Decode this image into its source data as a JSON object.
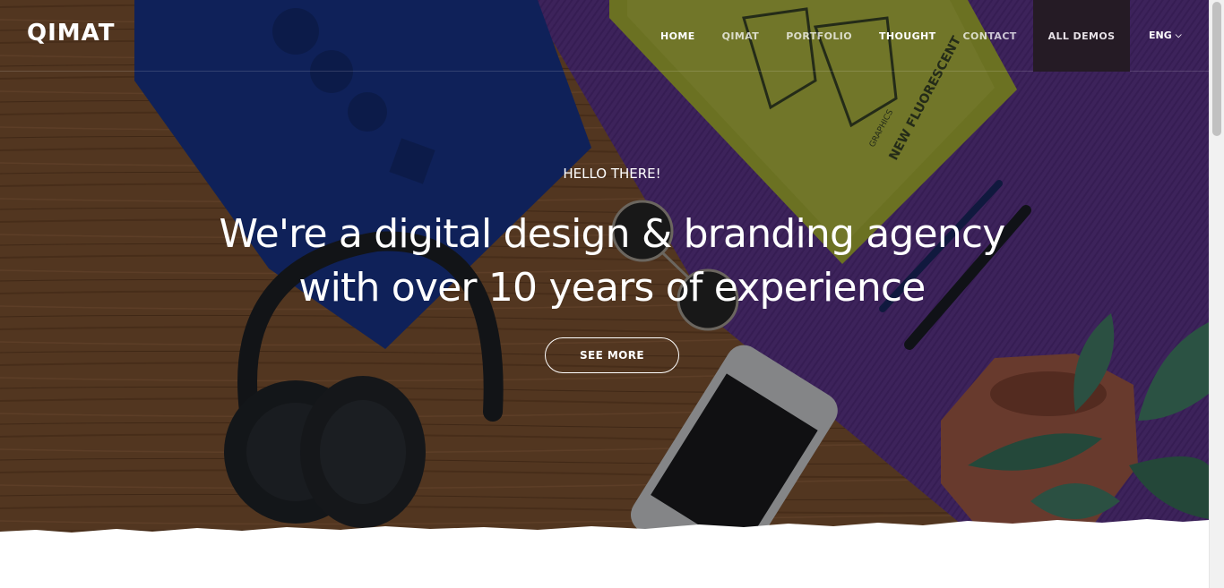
{
  "header": {
    "logo": "QIMAT",
    "nav": [
      {
        "label": "HOME"
      },
      {
        "label": "QIMAT"
      },
      {
        "label": "PORTFOLIO"
      },
      {
        "label": "THOUGHT"
      },
      {
        "label": "CONTACT"
      }
    ],
    "all_demos": "ALL DEMOS",
    "language": "ENG"
  },
  "hero": {
    "eyebrow": "HELLO THERE!",
    "headline_line1": "We're a digital design & branding agency",
    "headline_line2": "with over 10 years of experience",
    "cta": "SEE MORE"
  },
  "book": {
    "title": "NEW FLUORESCENT",
    "subtitle": "GRAPHICS"
  },
  "colors": {
    "overlay": "#000000",
    "demos_bg": "#251b25",
    "wood": "#8a5a36",
    "notebook_blue": "#1b3a9a",
    "mat_purple": "#6d3fa0",
    "book_green": "#b8c23a"
  },
  "icons": {
    "language_caret": "chevron-down-icon"
  }
}
